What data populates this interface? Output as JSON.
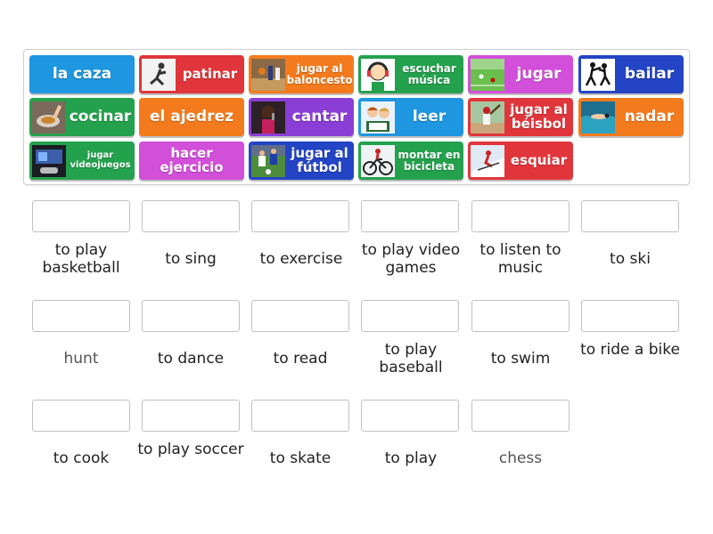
{
  "tray": {
    "tiles": [
      {
        "label": "la caza",
        "color": "#1e96e0",
        "image": null
      },
      {
        "label": "patinar",
        "color": "#e0363b",
        "image": "skater-photo"
      },
      {
        "label": "jugar al baloncesto",
        "color": "#f37b1d",
        "image": "basketball-photo"
      },
      {
        "label": "escuchar música",
        "color": "#24a14d",
        "image": "girl-headphones-cartoon"
      },
      {
        "label": "jugar",
        "color": "#d24fd9",
        "image": "soccer-field-photo"
      },
      {
        "label": "bailar",
        "color": "#2344c4",
        "image": "dancers-silhouette"
      },
      {
        "label": "cocinar",
        "color": "#24a14d",
        "image": "cooking-photo"
      },
      {
        "label": "el ajedrez",
        "color": "#f37b1d",
        "image": null
      },
      {
        "label": "cantar",
        "color": "#8b3ed6",
        "image": "singer-photo"
      },
      {
        "label": "leer",
        "color": "#1e96e0",
        "image": "kids-reading-photo"
      },
      {
        "label": "jugar al béisbol",
        "color": "#e0363b",
        "image": "baseball-photo"
      },
      {
        "label": "nadar",
        "color": "#f37b1d",
        "image": "swimmer-photo"
      },
      {
        "label": "jugar videojuegos",
        "color": "#24a14d",
        "image": "videogames-photo"
      },
      {
        "label": "hacer ejercicio",
        "color": "#d24fd9",
        "image": null
      },
      {
        "label": "jugar al fútbol",
        "color": "#2344c4",
        "image": "soccer-players-photo"
      },
      {
        "label": "montar en bicicleta",
        "color": "#24a14d",
        "image": "cyclist-photo"
      },
      {
        "label": "esquiar",
        "color": "#e0363b",
        "image": "skier-photo"
      }
    ]
  },
  "targets": [
    {
      "clue": "to play basketball"
    },
    {
      "clue": "to sing"
    },
    {
      "clue": "to exercise"
    },
    {
      "clue": "to play video games"
    },
    {
      "clue": "to listen to music"
    },
    {
      "clue": "to ski"
    },
    {
      "clue": "hunt"
    },
    {
      "clue": "to dance"
    },
    {
      "clue": "to read"
    },
    {
      "clue": "to play baseball"
    },
    {
      "clue": "to swim"
    },
    {
      "clue": "to ride a bike"
    },
    {
      "clue": "to cook"
    },
    {
      "clue": "to play soccer"
    },
    {
      "clue": "to skate"
    },
    {
      "clue": "to play"
    },
    {
      "clue": "chess"
    }
  ]
}
